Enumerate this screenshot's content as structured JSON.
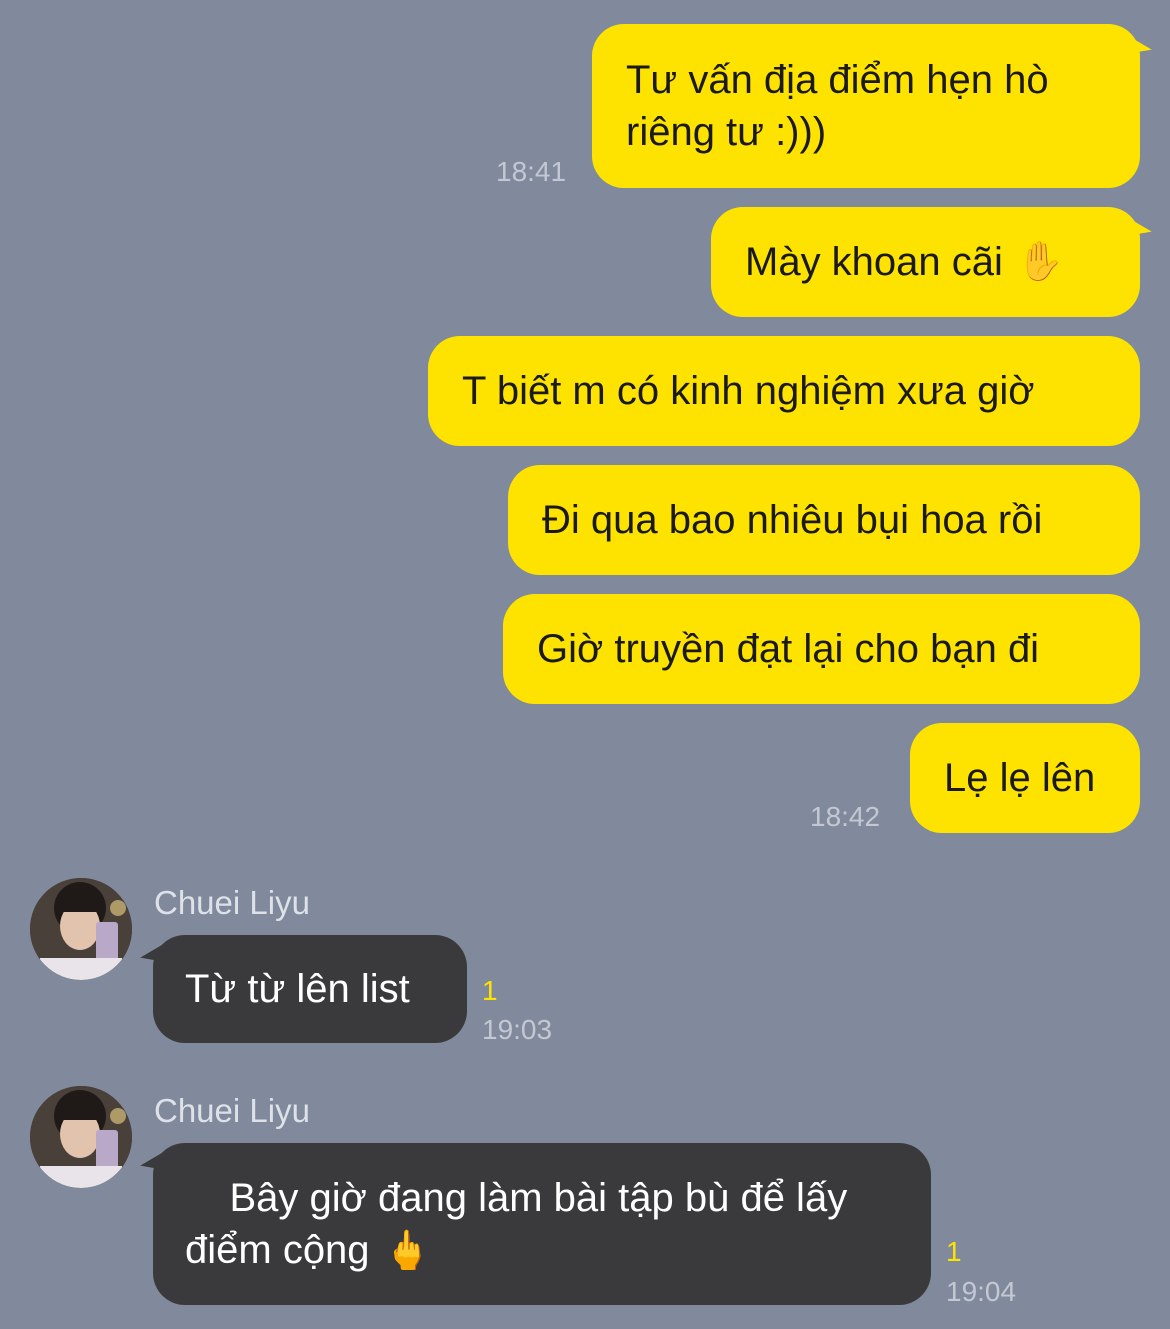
{
  "chat": {
    "outgoing": [
      {
        "text": "Tư vấn địa điểm hẹn hò\nriêng tư :)))",
        "time": "18:41"
      },
      {
        "text": "Mày khoan cãi",
        "emoji": "✋"
      },
      {
        "text": "T biết m có kinh nghiệm xưa giờ"
      },
      {
        "text": "Đi qua bao nhiêu bụi hoa rồi"
      },
      {
        "text": "Giờ truyền đạt lại cho bạn đi"
      },
      {
        "text": "Lẹ lẹ lên",
        "time": "18:42"
      }
    ],
    "incoming": [
      {
        "sender": "Chuei Liyu",
        "text": "Từ từ lên list",
        "unread": "1",
        "time": "19:03"
      },
      {
        "sender": "Chuei Liyu",
        "text": "Bây giờ đang làm bài tập bù để lấy\nđiểm cộng",
        "emoji": "🖕",
        "unread": "1",
        "time": "19:04"
      }
    ]
  },
  "colors": {
    "background": "#808a9c",
    "outgoing_bubble": "#ffe300",
    "incoming_bubble": "#3a3a3d",
    "unread": "#ffe300"
  },
  "icons": {
    "avatar": "avatar-photo",
    "raised_hand": "raised-hand-emoji",
    "middle_finger": "middle-finger-emoji"
  }
}
